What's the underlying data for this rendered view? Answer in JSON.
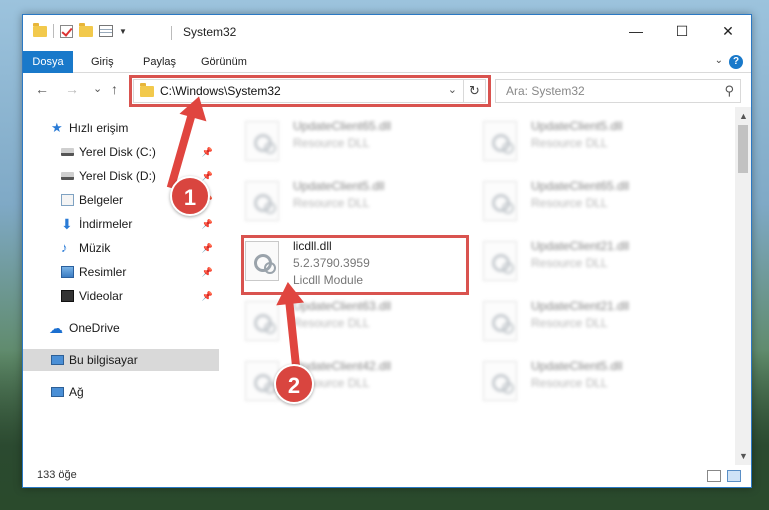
{
  "window": {
    "title": "System32",
    "controls": {
      "minimize": "—",
      "maximize": "☐",
      "close": "✕"
    }
  },
  "ribbon": {
    "tabs": [
      {
        "label": "Dosya"
      },
      {
        "label": "Giriş"
      },
      {
        "label": "Paylaş"
      },
      {
        "label": "Görünüm"
      }
    ],
    "help": "?"
  },
  "navigation": {
    "back": "←",
    "forward": "→",
    "recent": "⌄",
    "up": "↑",
    "address": "C:\\Windows\\System32",
    "search_placeholder": "Ara: System32"
  },
  "sidebar": {
    "items": [
      {
        "label": "Hızlı erişim",
        "icon": "star-icon",
        "pinned": false
      },
      {
        "label": "Yerel Disk (C:)",
        "icon": "disk-icon",
        "pinned": true
      },
      {
        "label": "Yerel Disk (D:)",
        "icon": "disk-icon",
        "pinned": true
      },
      {
        "label": "Belgeler",
        "icon": "documents-icon",
        "pinned": true
      },
      {
        "label": "İndirmeler",
        "icon": "downloads-icon",
        "pinned": true
      },
      {
        "label": "Müzik",
        "icon": "music-icon",
        "pinned": true
      },
      {
        "label": "Resimler",
        "icon": "pictures-icon",
        "pinned": true
      },
      {
        "label": "Videolar",
        "icon": "videos-icon",
        "pinned": true
      },
      {
        "label": "OneDrive",
        "icon": "onedrive-icon",
        "pinned": false
      },
      {
        "label": "Bu bilgisayar",
        "icon": "computer-icon",
        "pinned": false,
        "selected": true
      },
      {
        "label": "Ağ",
        "icon": "network-icon",
        "pinned": false
      }
    ]
  },
  "files": [
    {
      "name": "UpdateClient65.dll",
      "line2": "Resource DLL",
      "line3": "",
      "blurred": true
    },
    {
      "name": "UpdateClient5.dll",
      "line2": "Resource DLL",
      "line3": "",
      "blurred": true
    },
    {
      "name": "UpdateClient5.dll",
      "line2": "Resource DLL",
      "line3": "",
      "blurred": true
    },
    {
      "name": "UpdateClient65.dll",
      "line2": "Resource DLL",
      "line3": "",
      "blurred": true
    },
    {
      "name": "licdll.dll",
      "line2": "5.2.3790.3959",
      "line3": "Licdll Module",
      "blurred": false
    },
    {
      "name": "UpdateClient21.dll",
      "line2": "Resource DLL",
      "line3": "",
      "blurred": true
    },
    {
      "name": "UpdateClient63.dll",
      "line2": "Resource DLL",
      "line3": "",
      "blurred": true
    },
    {
      "name": "UpdateClient21.dll",
      "line2": "Resource DLL",
      "line3": "",
      "blurred": true
    },
    {
      "name": "UpdateClient42.dll",
      "line2": "Resource DLL",
      "line3": "",
      "blurred": true
    },
    {
      "name": "UpdateClient5.dll",
      "line2": "Resource DLL",
      "line3": "",
      "blurred": true
    }
  ],
  "status": {
    "item_count": "133 öğe"
  },
  "callouts": [
    {
      "number": "1"
    },
    {
      "number": "2"
    }
  ],
  "colors": {
    "accent": "#1979ca",
    "highlight": "#d9534f"
  }
}
